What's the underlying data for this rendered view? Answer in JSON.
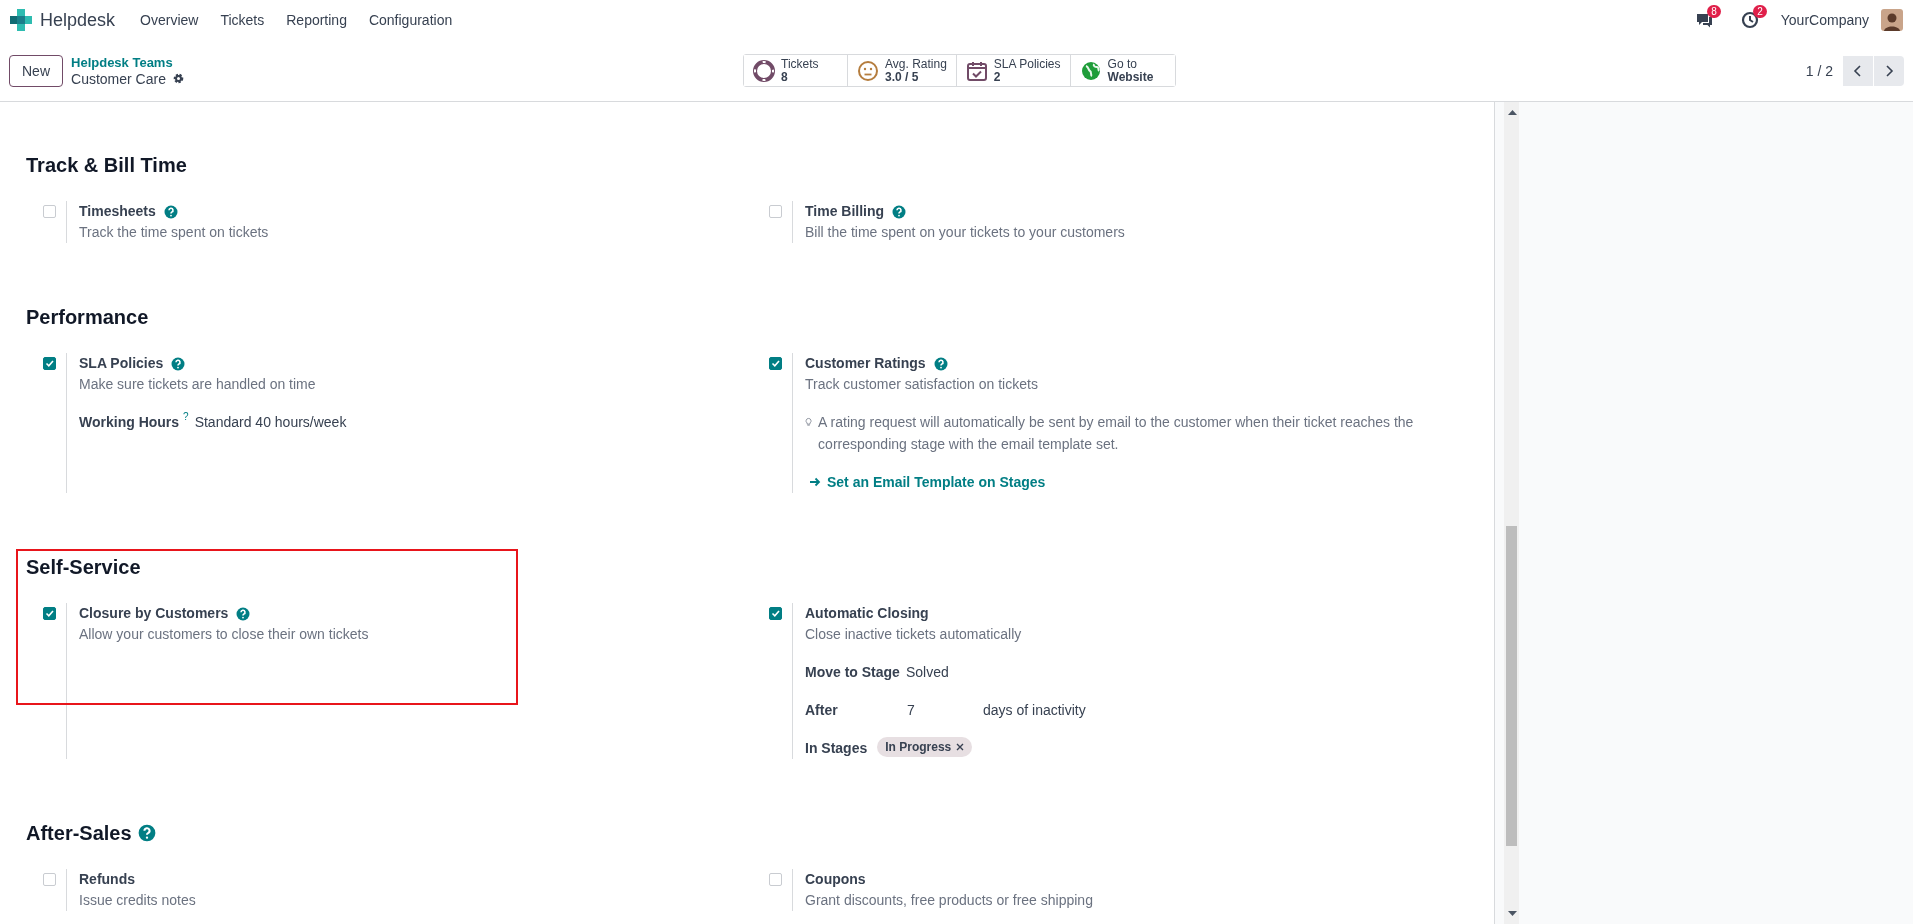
{
  "app": {
    "name": "Helpdesk"
  },
  "menu": [
    "Overview",
    "Tickets",
    "Reporting",
    "Configuration"
  ],
  "systray": [
    {
      "kind": "chat",
      "badge": "8"
    },
    {
      "kind": "activity",
      "badge": "2"
    }
  ],
  "company": "YourCompany",
  "control_panel": {
    "new_button": "New",
    "breadcrumb": {
      "parent": "Helpdesk Teams",
      "current": "Customer Care"
    },
    "stat_buttons": [
      {
        "kind": "tickets",
        "label": "Tickets",
        "value": "8"
      },
      {
        "kind": "rating",
        "label": "Avg. Rating",
        "value": "3.0 / 5"
      },
      {
        "kind": "sla",
        "label": "SLA Policies",
        "value": "2"
      },
      {
        "kind": "website",
        "label": "Go to",
        "value": "Website"
      }
    ],
    "pager": "1 / 2"
  },
  "sections": [
    {
      "title": "Track & Bill Time",
      "help": false,
      "highlighted": false,
      "settings": [
        {
          "title": "Timesheets",
          "help": true,
          "checked": false,
          "description": "Track the time spent on tickets"
        },
        {
          "title": "Time Billing",
          "help": true,
          "checked": false,
          "description": "Bill the time spent on your tickets to your customers"
        }
      ]
    },
    {
      "title": "Performance",
      "help": false,
      "highlighted": false,
      "settings": [
        {
          "title": "SLA Policies",
          "help": true,
          "checked": true,
          "description": "Make sure tickets are handled on time",
          "extras": [
            {
              "kind": "field",
              "label": "Working Hours",
              "tooltip": "?",
              "value": "Standard 40 hours/week"
            }
          ]
        },
        {
          "title": "Customer Ratings",
          "help": true,
          "checked": true,
          "description": "Track customer satisfaction on tickets",
          "extras": [
            {
              "kind": "note",
              "text": "A rating request will automatically be sent by email to the customer when their ticket reaches the corresponding stage with the email template set."
            },
            {
              "kind": "link",
              "text": "Set an Email Template on Stages"
            }
          ]
        }
      ]
    },
    {
      "title": "Self-Service",
      "help": false,
      "highlighted": true,
      "settings": [
        {
          "title": "Closure by Customers",
          "help": true,
          "checked": true,
          "description": "Allow your customers to close their own tickets"
        },
        {
          "title": "Automatic Closing",
          "help": false,
          "checked": true,
          "description": "Close inactive tickets automatically",
          "extras": [
            {
              "kind": "field",
              "label": "Move to Stage",
              "value": "Solved"
            },
            {
              "kind": "after",
              "label": "After",
              "value": "7",
              "suffix": "days of inactivity"
            },
            {
              "kind": "tags",
              "label": "In Stages",
              "tags": [
                "In Progress"
              ]
            }
          ]
        }
      ]
    },
    {
      "title": "After-Sales",
      "help": true,
      "highlighted": false,
      "settings": [
        {
          "title": "Refunds",
          "help": false,
          "checked": false,
          "description": "Issue credits notes"
        },
        {
          "title": "Coupons",
          "help": false,
          "checked": false,
          "description": "Grant discounts, free products or free shipping"
        }
      ]
    }
  ]
}
